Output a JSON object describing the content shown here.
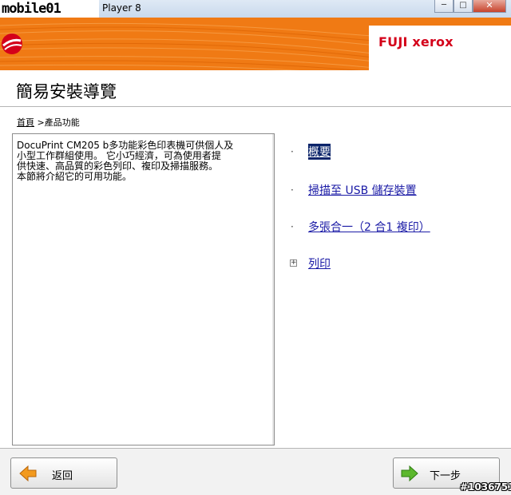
{
  "window": {
    "title_logo": "mobile01",
    "title": "Player 8",
    "minimize_label": "─",
    "maximize_label": "□",
    "close_label": "✕"
  },
  "banner": {
    "brand": "FUJI xerox"
  },
  "page": {
    "title": "簡易安裝導覽"
  },
  "breadcrumb": {
    "home": "首頁",
    "separator": ">",
    "current": "產品功能"
  },
  "description": {
    "text": "DocuPrint CM205 b多功能彩色印表機可供個人及\n小型工作群組使用。 它小巧經濟，可為使用者提\n供快速、高品質的彩色列印、複印及掃描服務。\n本節將介紹它的可用功能。"
  },
  "links": [
    {
      "label": "概要",
      "marker": "·",
      "selected": true
    },
    {
      "label": "掃描至 USB 儲存裝置",
      "marker": "·",
      "selected": false
    },
    {
      "label": "多張合一（2 合1 複印）",
      "marker": "·",
      "selected": false
    },
    {
      "label": "列印",
      "marker": "+",
      "selected": false
    }
  ],
  "footer": {
    "back_label": "返回",
    "next_label": "下一步"
  },
  "watermark": "#1036751",
  "colors": {
    "banner_orange": "#f07a14",
    "link": "#1a1aa6",
    "arrow_orange": "#f39a1e",
    "arrow_green": "#5cb82d"
  }
}
